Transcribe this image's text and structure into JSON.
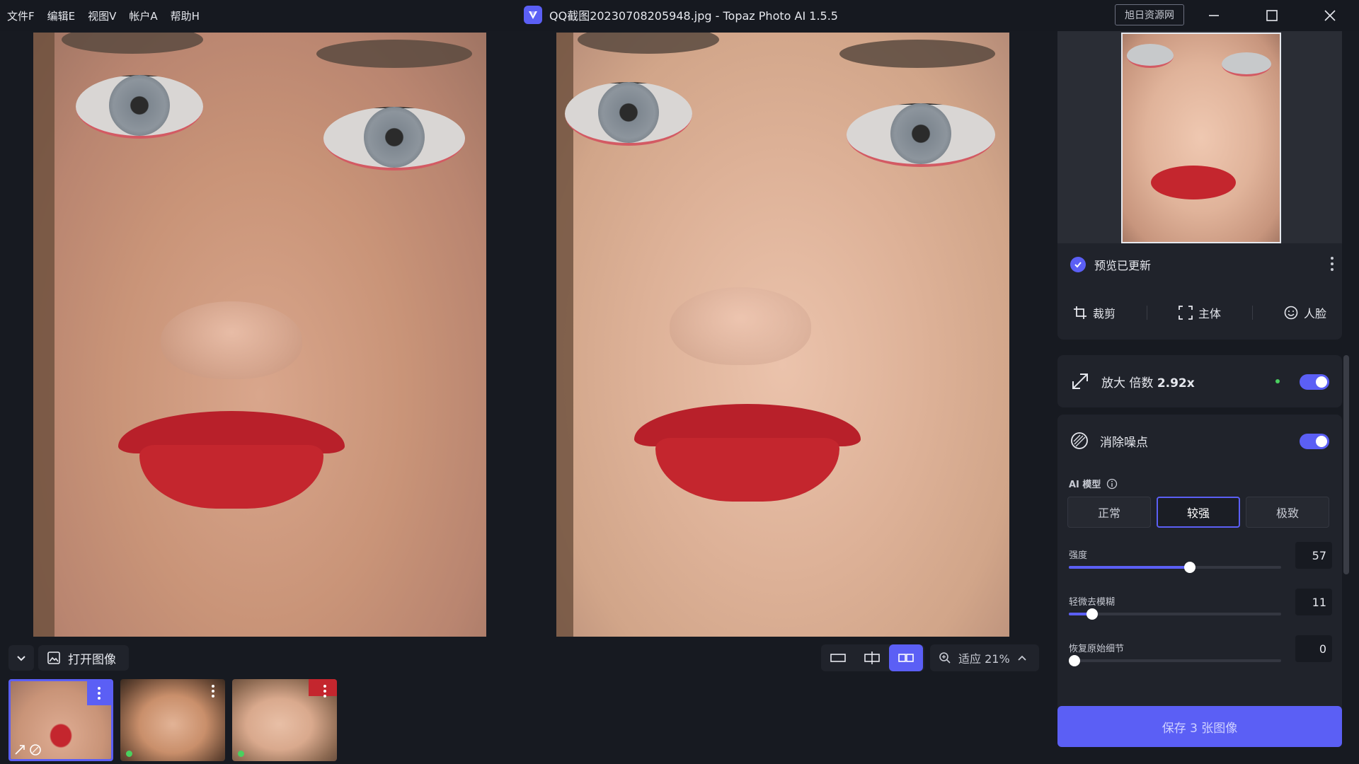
{
  "menu": [
    "文件F",
    "编辑E",
    "视图V",
    "帐户A",
    "帮助H"
  ],
  "window": {
    "title": "QQ截图20230708205948.jpg - Topaz Photo AI 1.5.5",
    "badge": "旭日资源网"
  },
  "viewer": {
    "open_image_label": "打开图像",
    "zoom_label": "适应 21%"
  },
  "sidebar": {
    "preview_status": "预览已更新",
    "tools": [
      "裁剪",
      "主体",
      "人脸"
    ],
    "upscale": {
      "label": "放大 倍数 ",
      "value": "2.92x"
    },
    "denoise": {
      "label": "消除噪点",
      "model_label": "AI 模型",
      "models": [
        "正常",
        "较强",
        "极致"
      ],
      "selected_model": "较强",
      "sliders": [
        {
          "label": "强度",
          "value": "57",
          "fraction": 0.57
        },
        {
          "label": "轻微去模糊",
          "value": "11",
          "fraction": 0.11
        },
        {
          "label": "恢复原始细节",
          "value": "0",
          "fraction": 0.0
        }
      ]
    },
    "save_label": "保存 3 张图像"
  },
  "colors": {
    "accent": "#5b5ff5",
    "bg": "#171a21",
    "panel": "#20232b",
    "status_green": "#4ad05f"
  },
  "icons": [
    "app-logo-icon",
    "minimize-icon",
    "maximize-icon",
    "close-icon",
    "check-icon",
    "more-vert-icon",
    "crop-icon",
    "subject-icon",
    "face-icon",
    "upscale-icon",
    "denoise-icon",
    "info-icon",
    "chevron-down-icon",
    "image-icon",
    "single-view-icon",
    "split-view-icon",
    "side-by-side-icon",
    "zoom-icon",
    "chevron-up-icon"
  ]
}
